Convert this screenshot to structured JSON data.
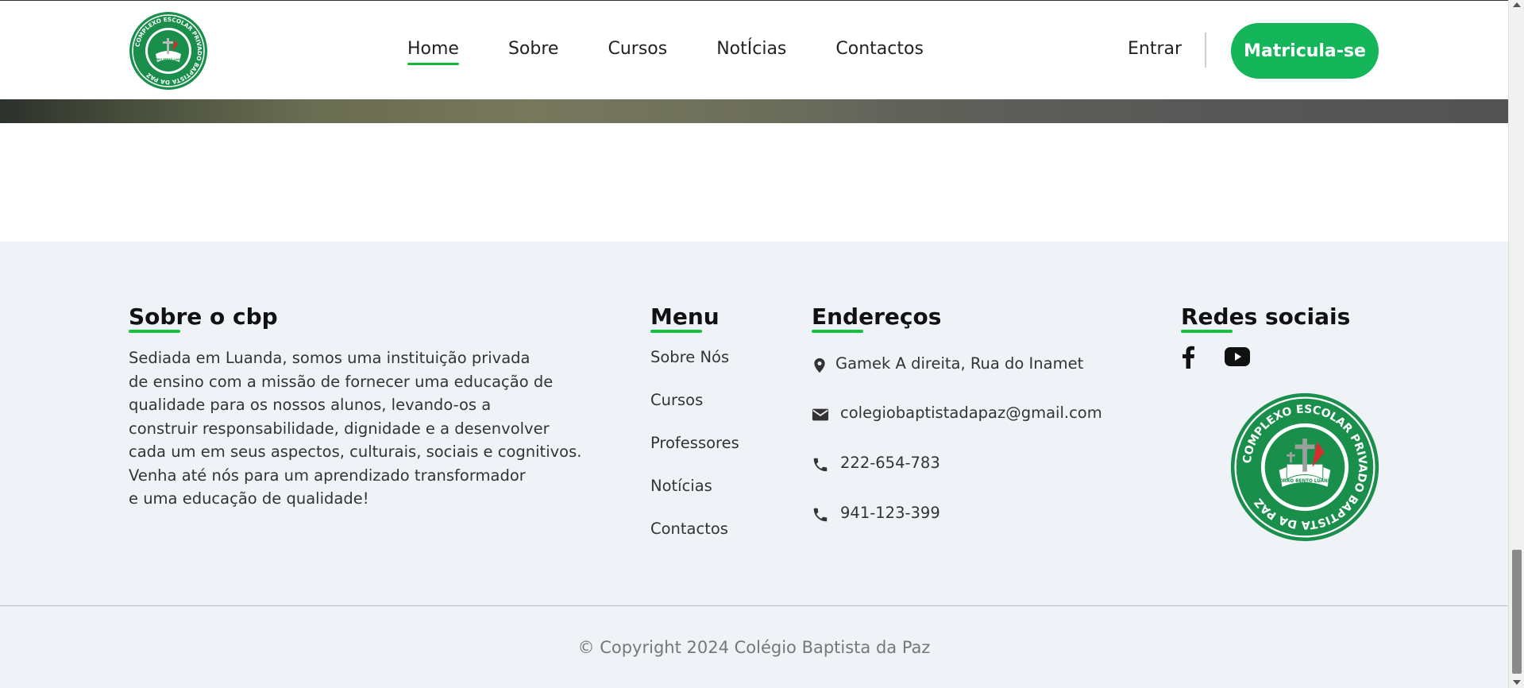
{
  "header": {
    "logo_text_ring": "COMPLEXO ESCOLAR PRIVADO BAPTISTA DA PAZ",
    "logo_text_inner": "MORRO BENTO LUANDA",
    "nav": [
      {
        "label": "Home",
        "active": true
      },
      {
        "label": "Sobre",
        "active": false
      },
      {
        "label": "Cursos",
        "active": false
      },
      {
        "label": "NotÍcias",
        "active": false
      },
      {
        "label": "Contactos",
        "active": false
      }
    ],
    "login_label": "Entrar",
    "cta_label": "Matricula-se"
  },
  "footer": {
    "about": {
      "title": "Sobre o cbp",
      "lines": [
        "Sediada em Luanda, somos uma instituição privada",
        "de ensino com a missão de fornecer uma educação de",
        "qualidade para os nossos alunos, levando-os a",
        "construir responsabilidade, dignidade e a desenvolver",
        "cada um em seus aspectos, culturais, sociais e cognitivos.",
        "Venha até nós para um aprendizado transformador",
        "e uma educação de qualidade!"
      ]
    },
    "menu": {
      "title": "Menu",
      "items": [
        "Sobre Nós",
        "Cursos",
        "Professores",
        "Notícias",
        "Contactos"
      ]
    },
    "addresses": {
      "title": "Endereços",
      "items": [
        {
          "icon": "map-pin-icon",
          "text": "Gamek A direita, Rua do Inamet"
        },
        {
          "icon": "envelope-icon",
          "text": "colegiobaptistadapaz@gmail.com"
        },
        {
          "icon": "phone-icon",
          "text": "222-654-783"
        },
        {
          "icon": "phone-icon",
          "text": "941-123-399"
        }
      ]
    },
    "social": {
      "title": "Redes sociais",
      "icons": [
        "facebook-icon",
        "youtube-icon"
      ]
    },
    "copyright": "© Copyright 2024 Colégio Baptista da Paz"
  },
  "colors": {
    "brand_green": "#15b55a",
    "accent_green": "#13c23c",
    "seal_green": "#1a8f4c",
    "footer_bg": "#eff3f7"
  }
}
